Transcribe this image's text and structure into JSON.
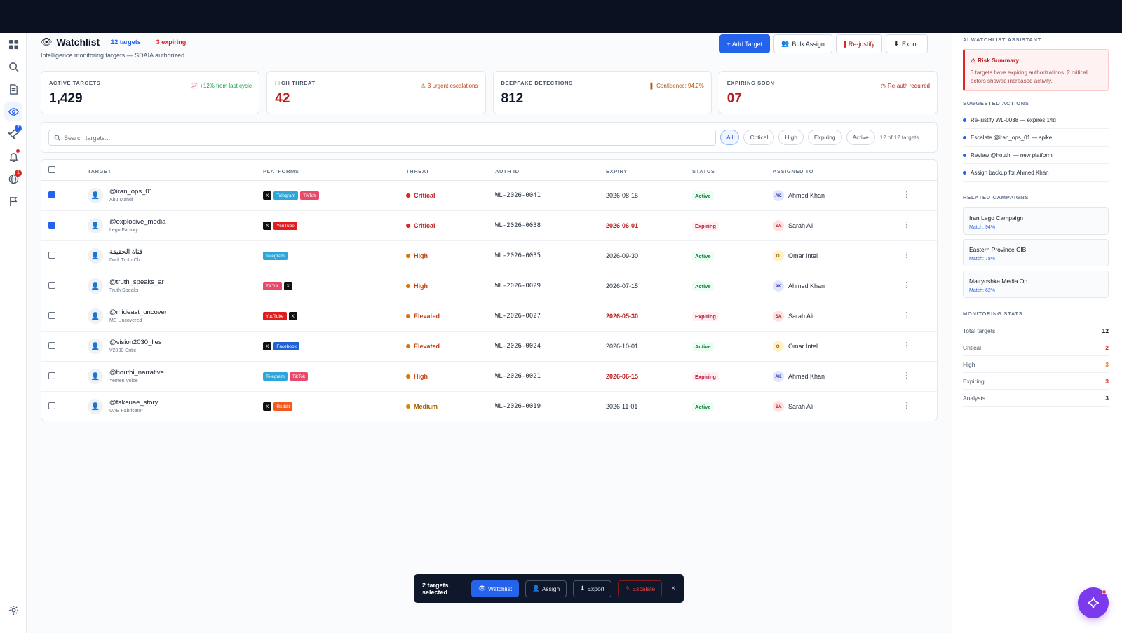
{
  "header": {
    "title": "Watchlist",
    "targets_pill": "12 targets",
    "expiring_pill": "3 expiring",
    "subtitle": "Intelligence monitoring targets — SDAIA authorized",
    "actions": {
      "add": "+ Add Target",
      "bulk_assign": "Bulk Assign",
      "rejustify": "Re-justify",
      "export": "Export"
    }
  },
  "nav": {
    "badge_pin": "7",
    "badge_globe": "1"
  },
  "stats": [
    {
      "label": "ACTIVE TARGETS",
      "value": "1,429",
      "note": "+12% from last cycle",
      "note_icon": "📈"
    },
    {
      "label": "HIGH THREAT",
      "value": "42",
      "note": "3 urgent escalations",
      "note_icon": "⚠"
    },
    {
      "label": "DEEPFAKE DETECTIONS",
      "value": "812",
      "note": "Confidence: 94.2%",
      "note_icon": "▌"
    },
    {
      "label": "EXPIRING SOON",
      "value": "07",
      "note": "Re-auth required",
      "note_icon": "◷"
    }
  ],
  "filters": {
    "search_placeholder": "Search targets...",
    "chips": [
      "All",
      "Critical",
      "High",
      "Expiring",
      "Active"
    ],
    "count": "12 of 12 targets"
  },
  "table": {
    "columns": [
      "TARGET",
      "PLATFORMS",
      "THREAT",
      "AUTH ID",
      "EXPIRY",
      "STATUS",
      "ASSIGNED TO"
    ],
    "rows": [
      {
        "name": "@iran_ops_01",
        "sub": "Abu Mahdi",
        "platforms": [
          "X",
          "Telegram",
          "TikTok"
        ],
        "threat": "Critical",
        "auth": "WL-2026-0041",
        "expiry": "2026-08-15",
        "expiry_alert": false,
        "status": "Active",
        "initials": "AK",
        "assignee": "Ahmed Khan",
        "checked": true
      },
      {
        "name": "@explosive_media",
        "sub": "Lego Factory",
        "platforms": [
          "X",
          "YouTube"
        ],
        "threat": "Critical",
        "auth": "WL-2026-0038",
        "expiry": "2026-06-01",
        "expiry_alert": true,
        "status": "Expiring",
        "initials": "SA",
        "assignee": "Sarah Ali",
        "checked": true
      },
      {
        "name": "قناة الحقيقة",
        "sub": "Dark Truth Ch.",
        "platforms": [
          "Telegram"
        ],
        "threat": "High",
        "auth": "WL-2026-0035",
        "expiry": "2026-09-30",
        "expiry_alert": false,
        "status": "Active",
        "initials": "OI",
        "assignee": "Omar Intel",
        "checked": false
      },
      {
        "name": "@truth_speaks_ar",
        "sub": "Truth Speaks",
        "platforms": [
          "TikTok",
          "X"
        ],
        "threat": "High",
        "auth": "WL-2026-0029",
        "expiry": "2026-07-15",
        "expiry_alert": false,
        "status": "Active",
        "initials": "AK",
        "assignee": "Ahmed Khan",
        "checked": false
      },
      {
        "name": "@mideast_uncover",
        "sub": "ME Uncovered",
        "platforms": [
          "YouTube",
          "X"
        ],
        "threat": "Elevated",
        "auth": "WL-2026-0027",
        "expiry": "2026-05-30",
        "expiry_alert": true,
        "status": "Expiring",
        "initials": "SA",
        "assignee": "Sarah Ali",
        "checked": false
      },
      {
        "name": "@vision2030_lies",
        "sub": "V2030 Critic",
        "platforms": [
          "X",
          "Facebook"
        ],
        "threat": "Elevated",
        "auth": "WL-2026-0024",
        "expiry": "2026-10-01",
        "expiry_alert": false,
        "status": "Active",
        "initials": "OI",
        "assignee": "Omar Intel",
        "checked": false
      },
      {
        "name": "@houthi_narrative",
        "sub": "Yemen Voice",
        "platforms": [
          "Telegram",
          "TikTok"
        ],
        "threat": "High",
        "auth": "WL-2026-0021",
        "expiry": "2026-06-15",
        "expiry_alert": true,
        "status": "Expiring",
        "initials": "AK",
        "assignee": "Ahmed Khan",
        "checked": false
      },
      {
        "name": "@fakeuae_story",
        "sub": "UAE Fabricator",
        "platforms": [
          "X",
          "Reddit"
        ],
        "threat": "Medium",
        "auth": "WL-2026-0019",
        "expiry": "2026-11-01",
        "expiry_alert": false,
        "status": "Active",
        "initials": "SA",
        "assignee": "Sarah Ali",
        "checked": false
      }
    ]
  },
  "bulk": {
    "count": "2 targets selected",
    "watchlist": "Watchlist",
    "assign": "Assign",
    "export": "Export",
    "escalate": "Escalate",
    "close": "×"
  },
  "assistant": {
    "title": "AI WATCHLIST ASSISTANT",
    "risk_title": "Risk Summary",
    "risk_body": "3 targets have expiring authorizations. 2 critical actors showed increased activity.",
    "actions_title": "SUGGESTED ACTIONS",
    "actions": [
      "Re-justify WL-0038 — expires 14d",
      "Escalate @iran_ops_01 — spike",
      "Review @houthi — new platform",
      "Assign backup for Ahmed Khan"
    ],
    "campaigns_title": "RELATED CAMPAIGNS",
    "campaigns": [
      {
        "name": "Iran Lego Campaign",
        "match": "Match: 94%"
      },
      {
        "name": "Eastern Province CIB",
        "match": "Match: 78%"
      },
      {
        "name": "Matryoshka Media Op",
        "match": "Match: 62%"
      }
    ],
    "stats_title": "MONITORING STATS",
    "stats": [
      {
        "label": "Total targets",
        "value": "12"
      },
      {
        "label": "Critical",
        "value": "2"
      },
      {
        "label": "High",
        "value": "3"
      },
      {
        "label": "Expiring",
        "value": "3"
      },
      {
        "label": "Analysts",
        "value": "3"
      }
    ]
  },
  "colors": {
    "accent": "#2563eb",
    "critical": "#dc2626",
    "high": "#d97706",
    "fab": "#7c3aed",
    "platform": {
      "X": "#111111",
      "Telegram": "#2ea6d9",
      "TikTok": "#e84a6b",
      "YouTube": "#e11d1d",
      "Facebook": "#1d63d6",
      "Reddit": "#f05a1a"
    }
  }
}
